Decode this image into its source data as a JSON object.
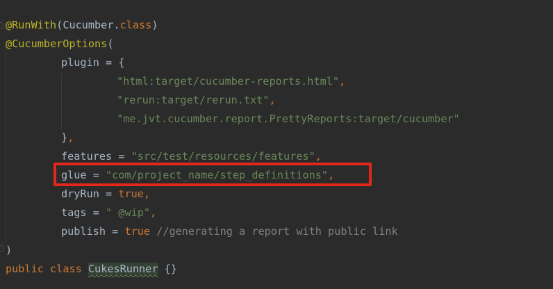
{
  "editor": {
    "lines": {
      "l1": {
        "annotation": "@RunWith",
        "open": "(",
        "classref": "Cucumber.",
        "kw": "class",
        "close": ")"
      },
      "l2": {
        "annotation": "@CucumberOptions",
        "open": "("
      },
      "l3": {
        "name": "plugin",
        "rest": " = {"
      },
      "l4": {
        "value": "\"html:target/cucumber-reports.html\"",
        "comma": ","
      },
      "l5": {
        "value": "\"rerun:target/rerun.txt\"",
        "comma": ","
      },
      "l6": {
        "value": "\"me.jvt.cucumber.report.PrettyReports:target/cucumber\""
      },
      "l7": {
        "brace": "}",
        "comma": ","
      },
      "l8": {
        "name": "features",
        "eq": " = ",
        "value": "\"src/test/resources/features\"",
        "comma": ","
      },
      "l9": {
        "name": "glue",
        "eq": " = ",
        "value": "\"com/project_name/step_definitions\"",
        "comma": ","
      },
      "l10": {
        "name": "dryRun",
        "eq": " = ",
        "value": "true",
        "comma": ","
      },
      "l11": {
        "name": "tags",
        "eq": " = ",
        "value": "\" @wip\"",
        "comma": ","
      },
      "l12": {
        "name": "publish",
        "eq": " = ",
        "value": "true",
        "comment": " //generating a report with public link"
      },
      "l13": {
        "close": ")"
      },
      "l14": {
        "kw1": "public",
        "kw2": "class",
        "classname": "CukesRunner",
        "body": " {}"
      }
    }
  },
  "colors": {
    "background": "#2b2b2b",
    "annotation": "#bbb529",
    "keyword": "#cc7832",
    "string": "#6a8759",
    "identifier": "#a9b7c6",
    "comment": "#808080",
    "highlight_box": "#e2271b"
  }
}
